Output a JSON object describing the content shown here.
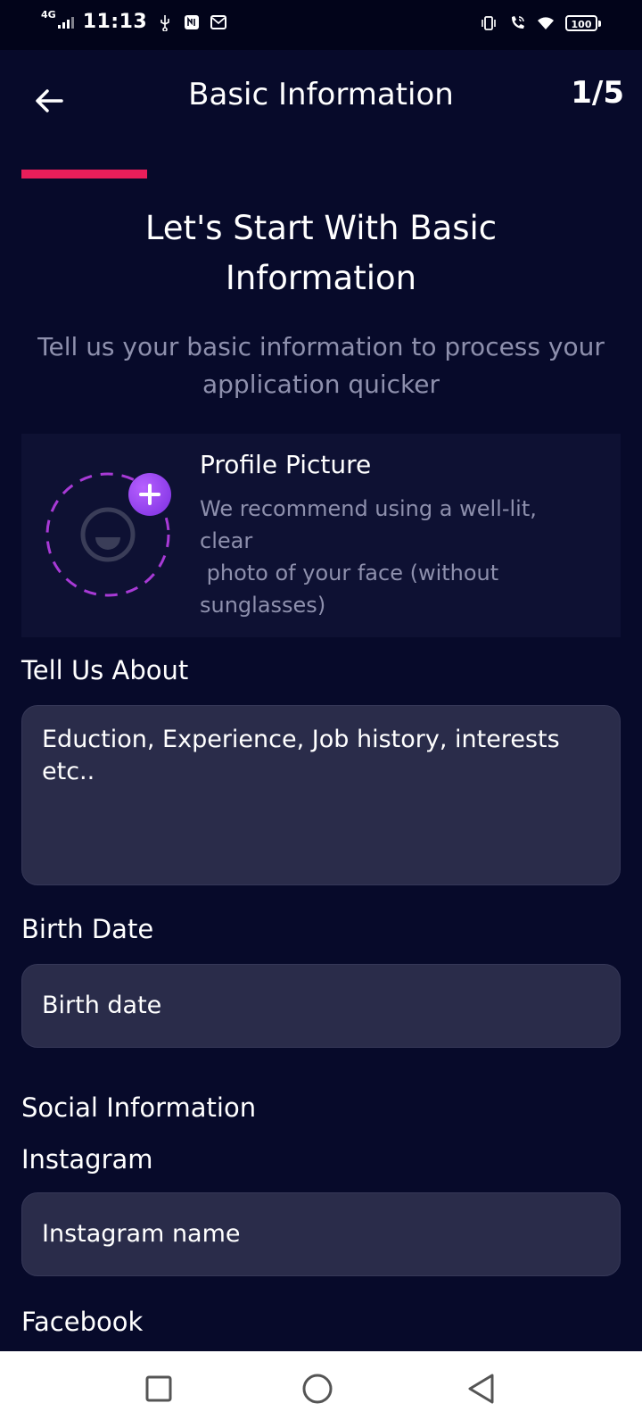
{
  "status_bar": {
    "network": "4G",
    "time": "11:13",
    "battery": "100",
    "icons": [
      "signal-icon",
      "usb-icon",
      "nfc-icon",
      "mail-icon",
      "vibrate-icon",
      "wifi-call-icon",
      "wifi-icon",
      "battery-icon"
    ]
  },
  "header": {
    "title": "Basic Information",
    "step": "1/5",
    "back_icon": "arrow-left-icon"
  },
  "progress": {
    "value": 0.2,
    "color": "#e91e5a"
  },
  "intro": {
    "headline": "Let's Start With Basic Information",
    "subhead": "Tell us your basic information to process your application quicker"
  },
  "profile": {
    "title": "Profile Picture",
    "description": "We recommend using a well-lit, clear\n photo of your face (without sunglasses)",
    "add_icon": "plus-icon",
    "avatar_icon": "avatar-placeholder-icon"
  },
  "form": {
    "about_label": "Tell Us About",
    "about_placeholder": "Eduction, Experience, Job history, interests etc..",
    "birth_label": "Birth Date",
    "birth_placeholder": "Birth date",
    "social_heading": "Social Information",
    "instagram_label": "Instagram",
    "instagram_placeholder": "Instagram name",
    "facebook_label": "Facebook"
  },
  "nav_bar": {
    "icons": [
      "recent-apps-icon",
      "home-icon",
      "back-icon"
    ]
  },
  "colors": {
    "background": "#070a2a",
    "accent": "#e91e5a",
    "field_bg": "#2a2c4a",
    "muted_text": "#8e90ad",
    "purple": "#9b45f0"
  }
}
